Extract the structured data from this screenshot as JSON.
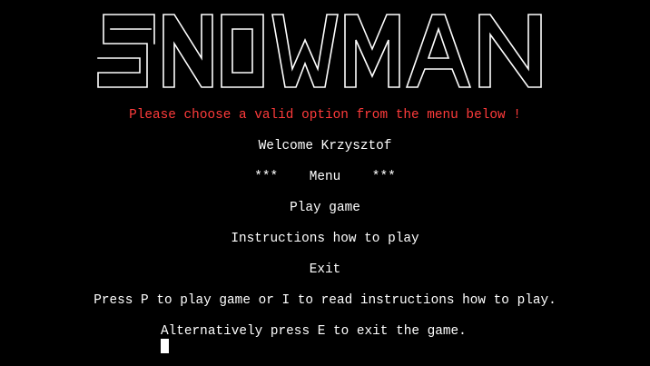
{
  "terminal": {
    "banner": {
      "art_text": "SNOWMAN",
      "stroke_color": "#ffffff"
    },
    "error_message": "Please choose a valid option from the menu below !",
    "error_color": "#ff3b3b",
    "welcome": "Welcome Krzysztof",
    "menu_title": "***    Menu    ***",
    "options": [
      "Play game",
      "Instructions how to play",
      "Exit"
    ],
    "prompt_line_1": "Press P to play game or I to read instructions how to play.",
    "prompt_line_2": "Alternatively press E to exit the game."
  }
}
